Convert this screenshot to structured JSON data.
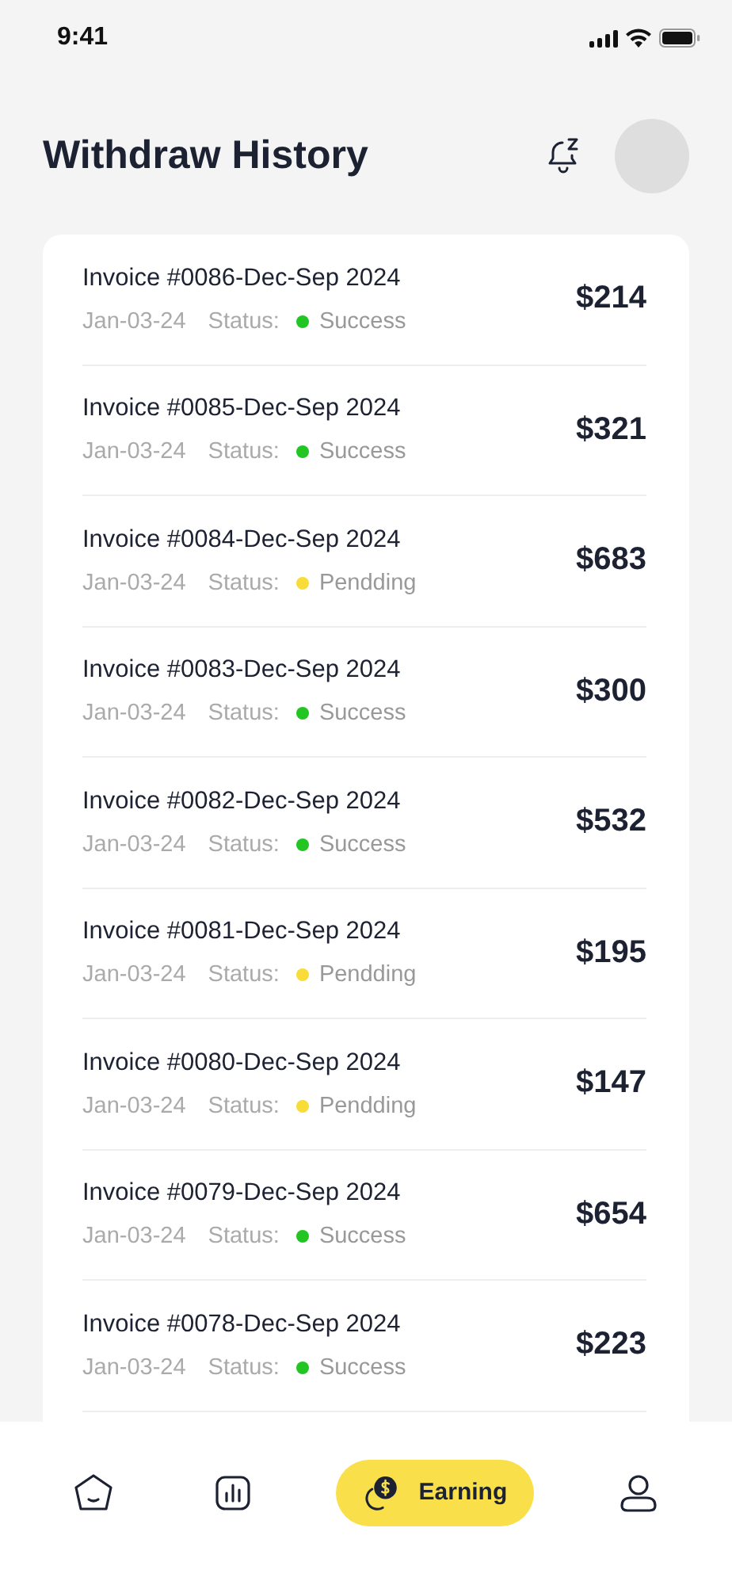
{
  "status_bar": {
    "time": "9:41"
  },
  "header": {
    "title": "Withdraw History"
  },
  "invoices": [
    {
      "title": "Invoice #0086-Dec-Sep 2024",
      "date": "Jan-03-24",
      "status_label": "Status:",
      "status": "Success",
      "color": "#22c522",
      "amount": "$214"
    },
    {
      "title": "Invoice #0085-Dec-Sep 2024",
      "date": "Jan-03-24",
      "status_label": "Status:",
      "status": "Success",
      "color": "#22c522",
      "amount": "$321"
    },
    {
      "title": "Invoice #0084-Dec-Sep 2024",
      "date": "Jan-03-24",
      "status_label": "Status:",
      "status": "Pendding",
      "color": "#f7dc3a",
      "amount": "$683"
    },
    {
      "title": "Invoice #0083-Dec-Sep 2024",
      "date": "Jan-03-24",
      "status_label": "Status:",
      "status": "Success",
      "color": "#22c522",
      "amount": "$300"
    },
    {
      "title": "Invoice #0082-Dec-Sep 2024",
      "date": "Jan-03-24",
      "status_label": "Status:",
      "status": "Success",
      "color": "#22c522",
      "amount": "$532"
    },
    {
      "title": "Invoice #0081-Dec-Sep 2024",
      "date": "Jan-03-24",
      "status_label": "Status:",
      "status": "Pendding",
      "color": "#f7dc3a",
      "amount": "$195"
    },
    {
      "title": "Invoice #0080-Dec-Sep 2024",
      "date": "Jan-03-24",
      "status_label": "Status:",
      "status": "Pendding",
      "color": "#f7dc3a",
      "amount": "$147"
    },
    {
      "title": "Invoice #0079-Dec-Sep 2024",
      "date": "Jan-03-24",
      "status_label": "Status:",
      "status": "Success",
      "color": "#22c522",
      "amount": "$654"
    },
    {
      "title": "Invoice #0078-Dec-Sep 2024",
      "date": "Jan-03-24",
      "status_label": "Status:",
      "status": "Success",
      "color": "#22c522",
      "amount": "$223"
    }
  ],
  "bottom_nav": [
    {
      "kind": "home",
      "selected": false
    },
    {
      "kind": "stats",
      "selected": false
    },
    {
      "kind": "earning",
      "label": "Earning",
      "selected": true
    },
    {
      "kind": "profile",
      "selected": false
    }
  ]
}
